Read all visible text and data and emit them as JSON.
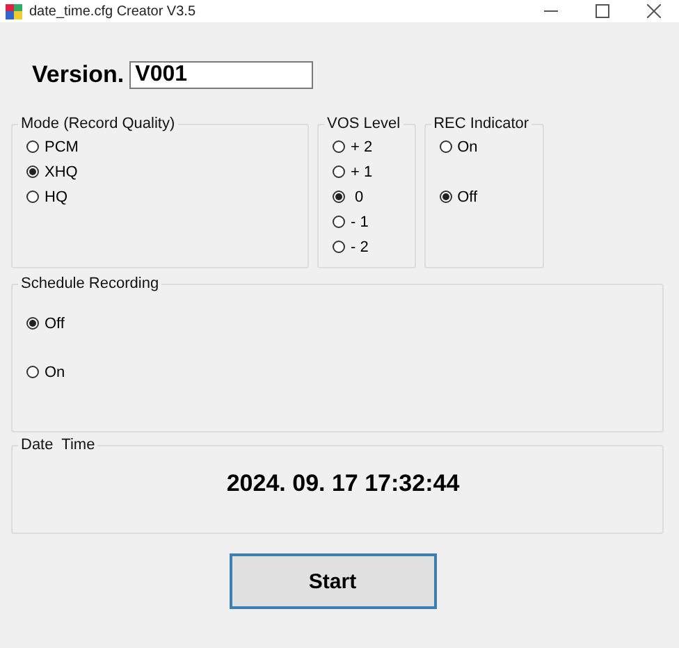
{
  "window": {
    "title": "date_time.cfg Creator V3.5"
  },
  "version": {
    "label": "Version.",
    "value": "V001"
  },
  "groups": [
    {
      "title": "Mode (Record Quality)",
      "kind": "mode",
      "options": [
        {
          "label": "PCM",
          "selected": false
        },
        {
          "label": "XHQ",
          "selected": true
        },
        {
          "label": "HQ",
          "selected": false
        }
      ]
    },
    {
      "title": "VOS Level",
      "kind": "vos",
      "options": [
        {
          "label": "+ 2",
          "selected": false
        },
        {
          "label": "+ 1",
          "selected": false
        },
        {
          "label": " 0",
          "selected": true
        },
        {
          "label": "- 1",
          "selected": false
        },
        {
          "label": "- 2",
          "selected": false
        }
      ]
    },
    {
      "title": "REC Indicator",
      "kind": "rec",
      "options": [
        {
          "label": "On",
          "selected": false
        },
        {
          "label": "Off",
          "selected": true
        }
      ]
    }
  ],
  "schedule": {
    "title": "Schedule Recording",
    "options": [
      {
        "label": "Off",
        "selected": true
      },
      {
        "label": "On",
        "selected": false
      }
    ]
  },
  "date_time": {
    "title": "Date  Time",
    "value": "2024. 09. 17 17:32:44"
  },
  "buttons": [
    "Start"
  ]
}
